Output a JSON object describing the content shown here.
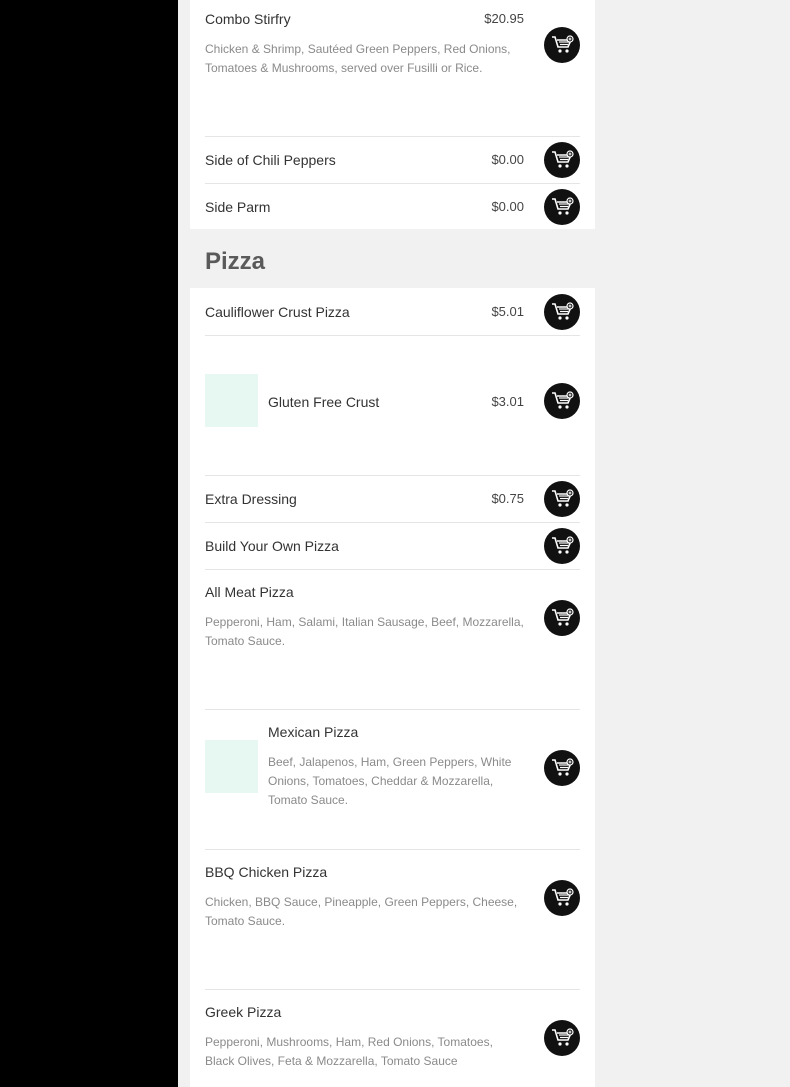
{
  "sections": [
    {
      "heading": "",
      "items": [
        {
          "name": "Combo Stirfry",
          "price": "$20.95",
          "description": "Chicken & Shrimp, Sautéed Green Peppers, Red Onions, Tomatoes & Mushrooms, served over Fusilli or Rice."
        },
        {
          "name": "Side of Chili Peppers",
          "price": "$0.00"
        },
        {
          "name": "Side Parm",
          "price": "$0.00"
        }
      ]
    },
    {
      "heading": "Pizza",
      "items": [
        {
          "name": "Cauliflower Crust Pizza",
          "price": "$5.01"
        },
        {
          "name": "Gluten Free Crust",
          "price": "$3.01"
        },
        {
          "name": "Extra Dressing",
          "price": "$0.75"
        },
        {
          "name": "Build Your Own Pizza",
          "price": ""
        },
        {
          "name": "All Meat Pizza",
          "price": "",
          "description": "Pepperoni, Ham, Salami, Italian Sausage, Beef, Mozzarella, Tomato Sauce."
        },
        {
          "name": "Mexican Pizza",
          "price": "",
          "description": "Beef, Jalapenos, Ham, Green Peppers, White Onions, Tomatoes, Cheddar & Mozzarella, Tomato Sauce."
        },
        {
          "name": "BBQ Chicken Pizza",
          "price": "",
          "description": "Chicken, BBQ Sauce, Pineapple, Green Peppers, Cheese, Tomato Sauce."
        },
        {
          "name": "Greek Pizza",
          "price": "",
          "description": "Pepperoni, Mushrooms, Ham, Red Onions, Tomatoes, Black Olives, Feta & Mozzarella, Tomato Sauce"
        }
      ]
    }
  ],
  "icons": {
    "add_to_cart": "add-to-cart-icon"
  },
  "colors": {
    "sidebar": "#000000",
    "cart_button": "#111111",
    "thumb_placeholder": "#e7f7f2"
  }
}
